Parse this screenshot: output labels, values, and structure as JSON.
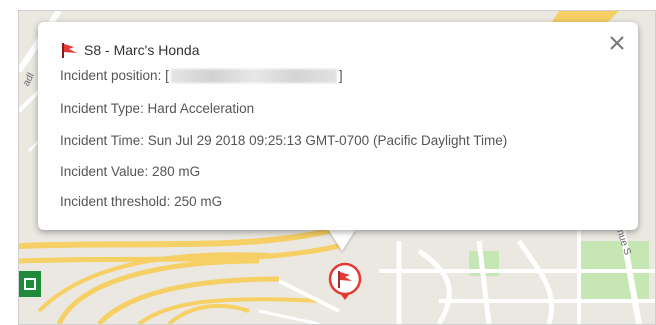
{
  "map": {
    "street_label_left": "adl",
    "street_label_right": "enue S",
    "colors": {
      "background": "#ebe8e2",
      "road": "#ffffff",
      "highway": "#f6cf65",
      "park": "#c6e6b4",
      "marker_red": "#e53935"
    }
  },
  "popup": {
    "title": "S8 - Marc's Honda",
    "title_icon": "red-flag-icon",
    "close_icon": "close-icon",
    "position": {
      "label": "Incident position: [",
      "value": "",
      "suffix": "]"
    },
    "type": "Incident Type: Hard Acceleration",
    "time": "Incident Time: Sun Jul 29 2018 09:25:13 GMT-0700 (Pacific Daylight Time)",
    "value": "Incident Value: 280 mG",
    "threshold": "Incident threshold: 250 mG"
  },
  "marker": {
    "icon": "red-flag-icon"
  }
}
